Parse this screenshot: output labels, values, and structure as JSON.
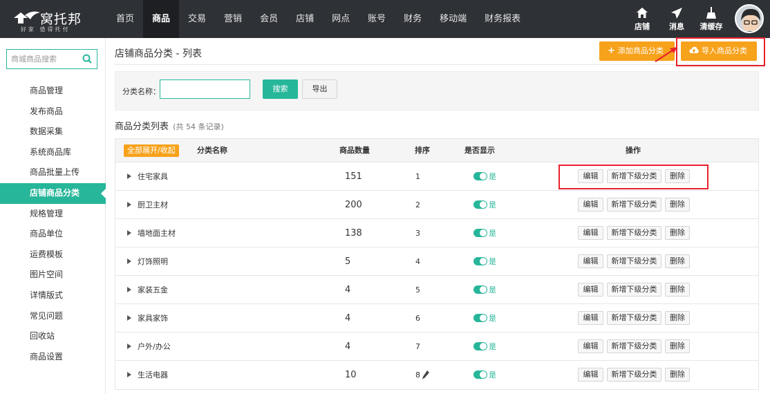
{
  "brand": {
    "name": "窝托邦",
    "slogan": "好家 值得托付"
  },
  "nav": [
    "首页",
    "商品",
    "交易",
    "营销",
    "会员",
    "店铺",
    "网点",
    "账号",
    "财务",
    "移动端",
    "财务报表"
  ],
  "nav_active_index": 1,
  "tools": [
    {
      "label": "店铺",
      "icon": "home-icon"
    },
    {
      "label": "消息",
      "icon": "paper-plane-icon"
    },
    {
      "label": "清缓存",
      "icon": "broom-icon"
    }
  ],
  "sidebar": {
    "search_placeholder": "商城商品搜索",
    "items": [
      "商品管理",
      "发布商品",
      "数据采集",
      "系统商品库",
      "商品批量上传",
      "店铺商品分类",
      "规格管理",
      "商品单位",
      "运费模板",
      "图片空间",
      "详情版式",
      "常见问题",
      "回收站",
      "商品设置"
    ],
    "active_index": 5
  },
  "page": {
    "title": "店铺商品分类 - 列表",
    "add_button": "添加商品分类",
    "import_button": "导入商品分类"
  },
  "search": {
    "label": "分类名称：",
    "value": "",
    "search_button": "搜索",
    "export_button": "导出"
  },
  "list": {
    "title": "商品分类列表",
    "count_text": "(共 54 条记录)",
    "toggle_all": "全部展开/收起",
    "headers": {
      "name": "分类名称",
      "qty": "商品数量",
      "sort": "排序",
      "visible": "是否显示",
      "ops": "操作"
    },
    "actions": {
      "edit": "编辑",
      "add_sub": "新增下级分类",
      "delete": "删除"
    },
    "rows": [
      {
        "name": "住宅家具",
        "qty": "151",
        "sort": "1",
        "visible": "是"
      },
      {
        "name": "厨卫主材",
        "qty": "200",
        "sort": "2",
        "visible": "是"
      },
      {
        "name": "墙地面主材",
        "qty": "138",
        "sort": "3",
        "visible": "是"
      },
      {
        "name": "灯饰照明",
        "qty": "5",
        "sort": "4",
        "visible": "是"
      },
      {
        "name": "家装五金",
        "qty": "4",
        "sort": "5",
        "visible": "是"
      },
      {
        "name": "家具家饰",
        "qty": "4",
        "sort": "6",
        "visible": "是"
      },
      {
        "name": "户外/办公",
        "qty": "4",
        "sort": "7",
        "visible": "是"
      },
      {
        "name": "生活电器",
        "qty": "10",
        "sort": "8",
        "visible": "是"
      }
    ]
  },
  "colors": {
    "topbar": "#2e3135",
    "accent": "#27b69a",
    "orange": "#f7a21b",
    "highlight": "#e8212b"
  }
}
